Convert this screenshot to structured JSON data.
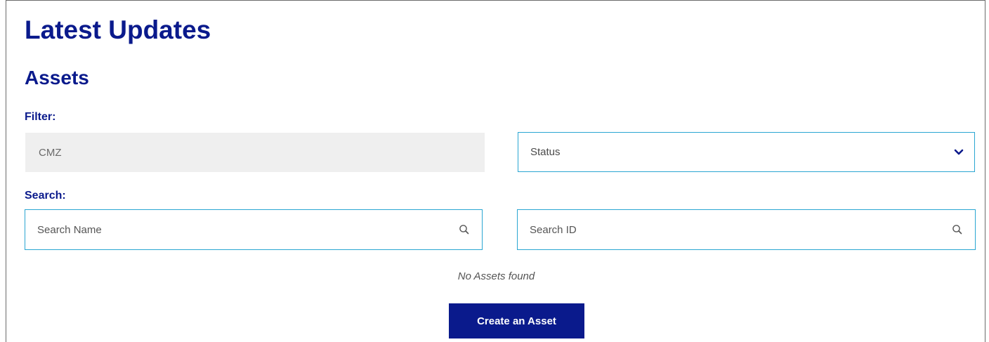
{
  "page": {
    "title": "Latest Updates",
    "section_title": "Assets"
  },
  "filter": {
    "label": "Filter:",
    "readonly_value": "CMZ",
    "status_select": {
      "selected": "Status",
      "icon": "chevron-down-icon"
    }
  },
  "search": {
    "label": "Search:",
    "name_placeholder": "Search Name",
    "id_placeholder": "Search ID",
    "icon": "search-icon"
  },
  "results": {
    "empty_message": "No Assets found"
  },
  "actions": {
    "create_label": "Create an Asset"
  },
  "colors": {
    "brand": "#0a1a8c",
    "input_border": "#2aa6d2",
    "readonly_background": "#efefef",
    "button_text": "#ffffff"
  }
}
